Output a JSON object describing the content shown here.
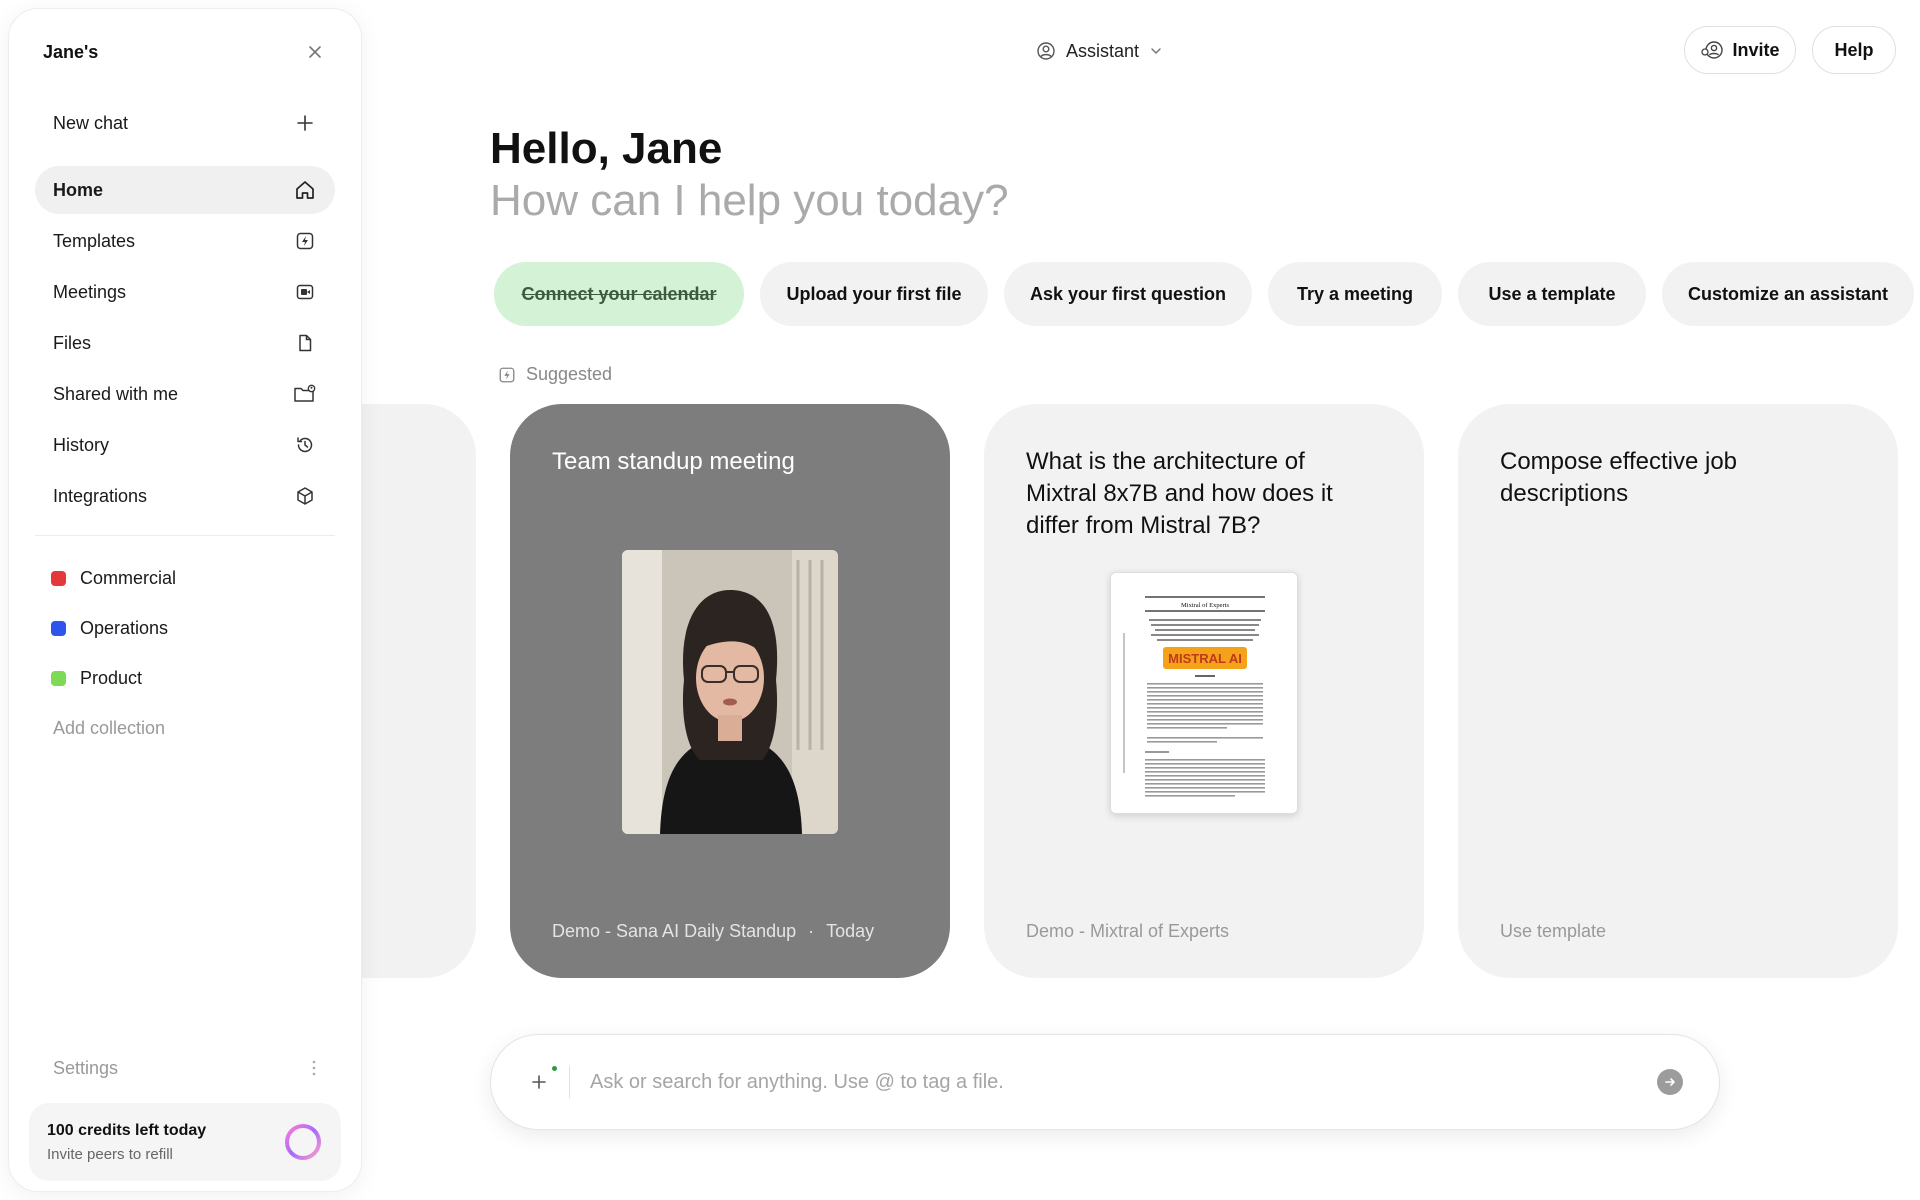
{
  "sidebar": {
    "workspace_title": "Jane's",
    "new_chat": "New chat",
    "nav": [
      {
        "label": "Home",
        "icon": "home-icon"
      },
      {
        "label": "Templates",
        "icon": "lightning-icon"
      },
      {
        "label": "Meetings",
        "icon": "video-icon"
      },
      {
        "label": "Files",
        "icon": "file-icon"
      },
      {
        "label": "Shared with me",
        "icon": "shared-folder-icon"
      },
      {
        "label": "History",
        "icon": "history-icon"
      },
      {
        "label": "Integrations",
        "icon": "cube-icon"
      }
    ],
    "active_item": "Home",
    "collections": [
      {
        "label": "Commercial",
        "color": "#e5383b"
      },
      {
        "label": "Operations",
        "color": "#2f54eb"
      },
      {
        "label": "Product",
        "color": "#7ed957"
      }
    ],
    "add_collection": "Add collection",
    "settings": "Settings",
    "credits_title": "100 credits left today",
    "credits_sub": "Invite peers to refill"
  },
  "topbar": {
    "assistant_label": "Assistant",
    "invite_label": "Invite",
    "help_label": "Help"
  },
  "main": {
    "greeting": "Hello, Jane",
    "subgreeting": "How can I help you today?",
    "chips": [
      {
        "label": "Connect your calendar",
        "done": true
      },
      {
        "label": "Upload your first file",
        "done": false
      },
      {
        "label": "Ask your first question",
        "done": false
      },
      {
        "label": "Try a meeting",
        "done": false
      },
      {
        "label": "Use a template",
        "done": false
      },
      {
        "label": "Customize an assistant",
        "done": false
      }
    ],
    "suggested_label": "Suggested",
    "cards": [
      {
        "title": "Team standup meeting",
        "footer": "Demo - Sana AI Daily Standup",
        "footer_time": "Today"
      },
      {
        "title": "What is the architecture of Mixtral 8x7B and how does it differ from Mistral 7B?",
        "footer": "Demo - Mixtral of Experts"
      },
      {
        "title": "Compose effective job descriptions",
        "footer": "Use template"
      }
    ],
    "paper_heading": "Mixtral of Experts",
    "paper_logo": "MISTRAL AI",
    "search_placeholder": "Ask or search for anything. Use @ to tag a file."
  }
}
